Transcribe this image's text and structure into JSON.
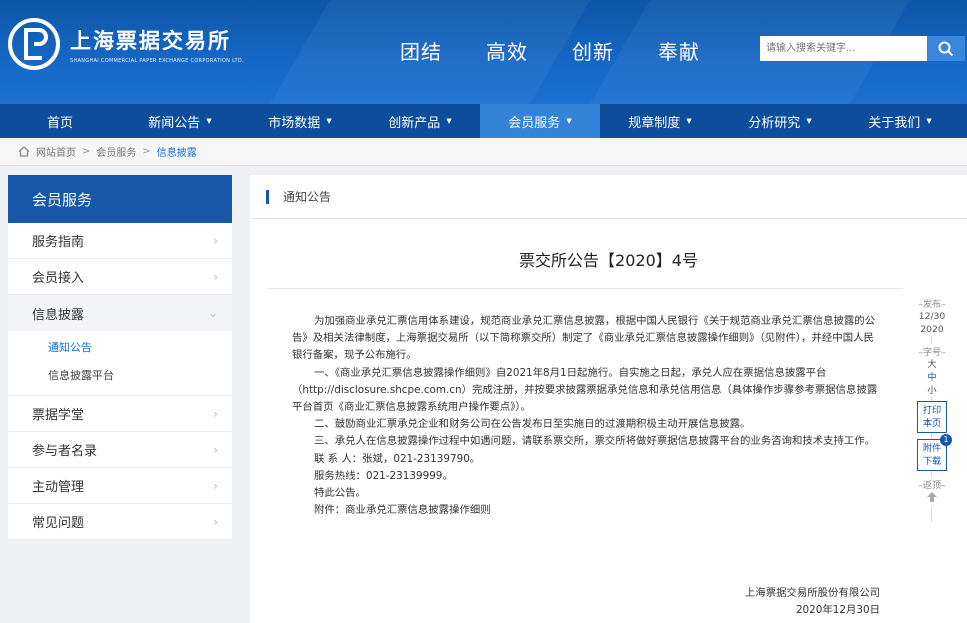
{
  "header": {
    "logo_cn": "上海票据交易所",
    "logo_en": "SHANGHAI COMMERCIAL PAPER EXCHANGE CORPORATION LTD.",
    "slogans": [
      "团结",
      "高效",
      "创新",
      "奉献"
    ],
    "search_placeholder": "请输入搜索关键字..."
  },
  "nav": [
    {
      "label": "首页",
      "caret": false
    },
    {
      "label": "新闻公告",
      "caret": true
    },
    {
      "label": "市场数据",
      "caret": true
    },
    {
      "label": "创新产品",
      "caret": true
    },
    {
      "label": "会员服务",
      "caret": true,
      "active": true
    },
    {
      "label": "规章制度",
      "caret": true
    },
    {
      "label": "分析研究",
      "caret": true
    },
    {
      "label": "关于我们",
      "caret": true
    }
  ],
  "breadcrumb": [
    "网站首页",
    "会员服务",
    "信息披露"
  ],
  "sidebar": {
    "title": "会员服务",
    "items": [
      {
        "label": "服务指南"
      },
      {
        "label": "会员接入"
      },
      {
        "label": "信息披露",
        "open": true,
        "sub": [
          {
            "label": "通知公告",
            "active": true
          },
          {
            "label": "信息披露平台"
          }
        ]
      },
      {
        "label": "票据学堂"
      },
      {
        "label": "参与者名录"
      },
      {
        "label": "主动管理"
      },
      {
        "label": "常见问题"
      }
    ]
  },
  "main": {
    "section": "通知公告",
    "title": "票交所公告【2020】4号",
    "p1": "为加强商业承兑汇票信用体系建设，规范商业承兑汇票信息披露，根据中国人民银行《关于规范商业承兑汇票信息披露的公告》及相关法律制度，上海票据交易所（以下简称票交所）制定了《商业承兑汇票信息披露操作细则》（见附件），并经中国人民银行备案，现予公布施行。",
    "p2": "一、《商业承兑汇票信息披露操作细则》自2021年8月1日起施行。自实施之日起，承兑人应在票据信息披露平台（http://disclosure.shcpe.com.cn）完成注册，并按要求披露票据承兑信息和承兑信用信息（具体操作步骤参考票据信息披露平台首页《商业汇票信息披露系统用户操作要点》）。",
    "p3": "二、鼓励商业汇票承兑企业和财务公司在公告发布日至实施日的过渡期积极主动开展信息披露。",
    "p4": "三、承兑人在信息披露操作过程中如遇问题，请联系票交所，票交所将做好票据信息披露平台的业务咨询和技术支持工作。",
    "contact": "联 系 人：张斌，021-23139790。",
    "hotline": "服务热线：021-23139999。",
    "notice": "特此公告。",
    "attachment": "附件：商业承兑汇票信息披露操作细则",
    "signer": "上海票据交易所股份有限公司",
    "sign_date": "2020年12月30日"
  },
  "tools": {
    "publish_label": "–发布–",
    "publish_date_1": "12/30",
    "publish_date_2": "2020",
    "font_label": "–字号–",
    "font_large": "大",
    "font_medium": "中",
    "font_small": "小",
    "print_1": "打印",
    "print_2": "本页",
    "attach_1": "附件",
    "attach_2": "下载",
    "attach_count": "1",
    "back_label": "–返顶–"
  }
}
